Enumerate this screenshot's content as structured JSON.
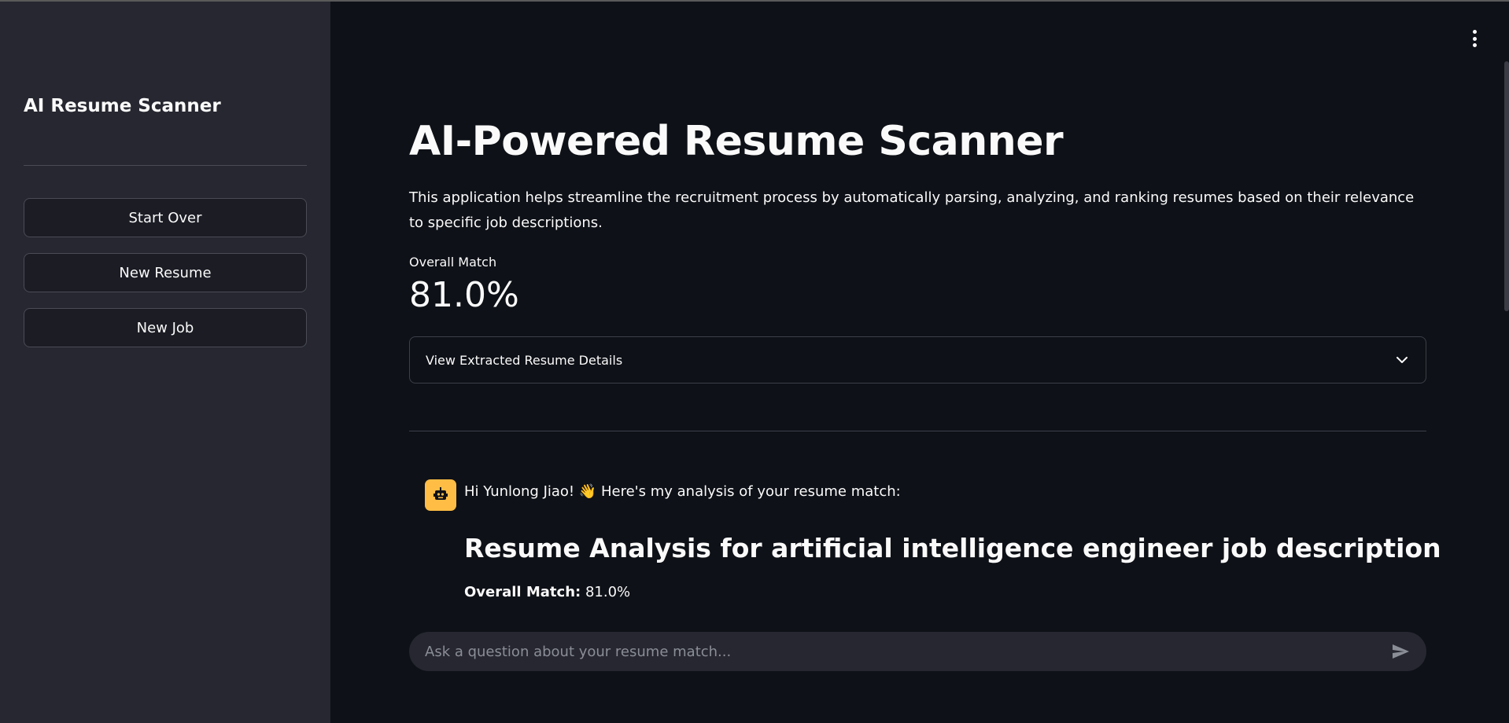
{
  "sidebar": {
    "title": "AI Resume Scanner",
    "buttons": [
      {
        "label": "Start Over"
      },
      {
        "label": "New Resume"
      },
      {
        "label": "New Job"
      }
    ]
  },
  "main": {
    "title": "AI-Powered Resume Scanner",
    "description": "This application helps streamline the recruitment process by automatically parsing, analyzing, and ranking resumes based on their relevance to specific job descriptions.",
    "metric": {
      "label": "Overall Match",
      "value": "81.0%"
    },
    "expander": {
      "label": "View Extracted Resume Details",
      "icon": "chevron-down-icon"
    },
    "chat": {
      "avatar_icon": "robot-icon",
      "greeting": "Hi Yunlong Jiao! 👋 Here's my analysis of your resume match:",
      "heading": "Resume Analysis for artificial intelligence engineer job description",
      "match_label": "Overall Match:",
      "match_value": "81.0%"
    },
    "chat_input": {
      "placeholder": "Ask a question about your resume match...",
      "send_icon": "send-icon"
    }
  },
  "menu_icon": "more-vertical-icon",
  "colors": {
    "background": "#0e1117",
    "sidebar": "#262730",
    "avatar": "#ffbd45",
    "text": "#fafafa"
  }
}
